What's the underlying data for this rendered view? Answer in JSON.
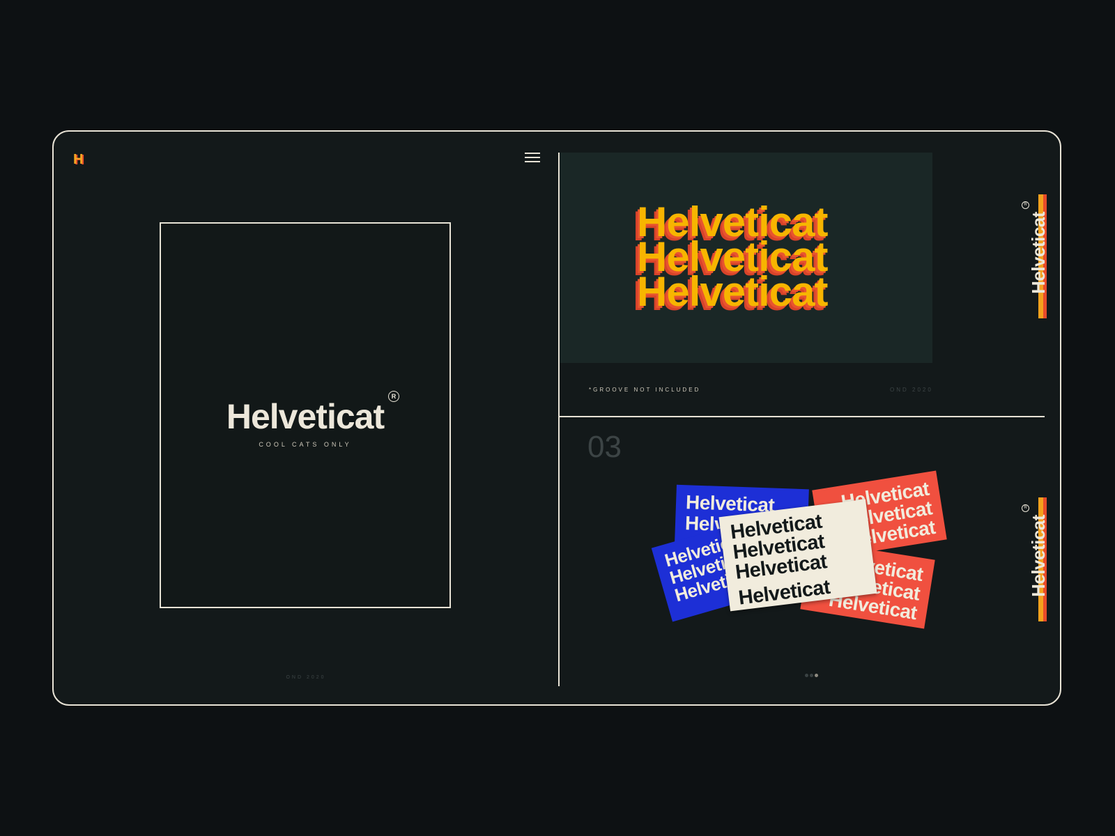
{
  "brand": {
    "logo_letter": "H"
  },
  "poster": {
    "title": "Helveticat",
    "registered": "R",
    "tagline": "COOL CATS ONLY",
    "footer_date": "OND 2020"
  },
  "hero": {
    "lines": [
      "Helveticat",
      "Helveticat",
      "Helveticat"
    ],
    "caption": "*GROOVE NOT INCLUDED",
    "date": "OND 2020"
  },
  "side_logo": {
    "word": "Helveticat",
    "registered": "R"
  },
  "stickers": {
    "section_number": "03",
    "blue": [
      "Helveticat",
      "Helveticat"
    ],
    "blue_back": [
      "Helveticat",
      "Helveticat",
      "Helveticat"
    ],
    "red": [
      "Helveticat",
      "Helveticat",
      "Helveticat"
    ],
    "red_back": [
      "Helveticat",
      "Helveticat",
      "Helveticat"
    ],
    "cream": [
      "Helveticat",
      "Helveticat",
      "Helveticat",
      "Helveticat"
    ]
  },
  "pager": {
    "active_index": 2,
    "count": 3
  },
  "colors": {
    "accent_orange": "#f7b500",
    "accent_red": "#e8542f",
    "blue_sticker": "#1d2fd6",
    "red_sticker": "#f0503f",
    "cream_sticker": "#f1ecdd",
    "frame_border": "#e8e3d6",
    "background": "#0d1113"
  }
}
